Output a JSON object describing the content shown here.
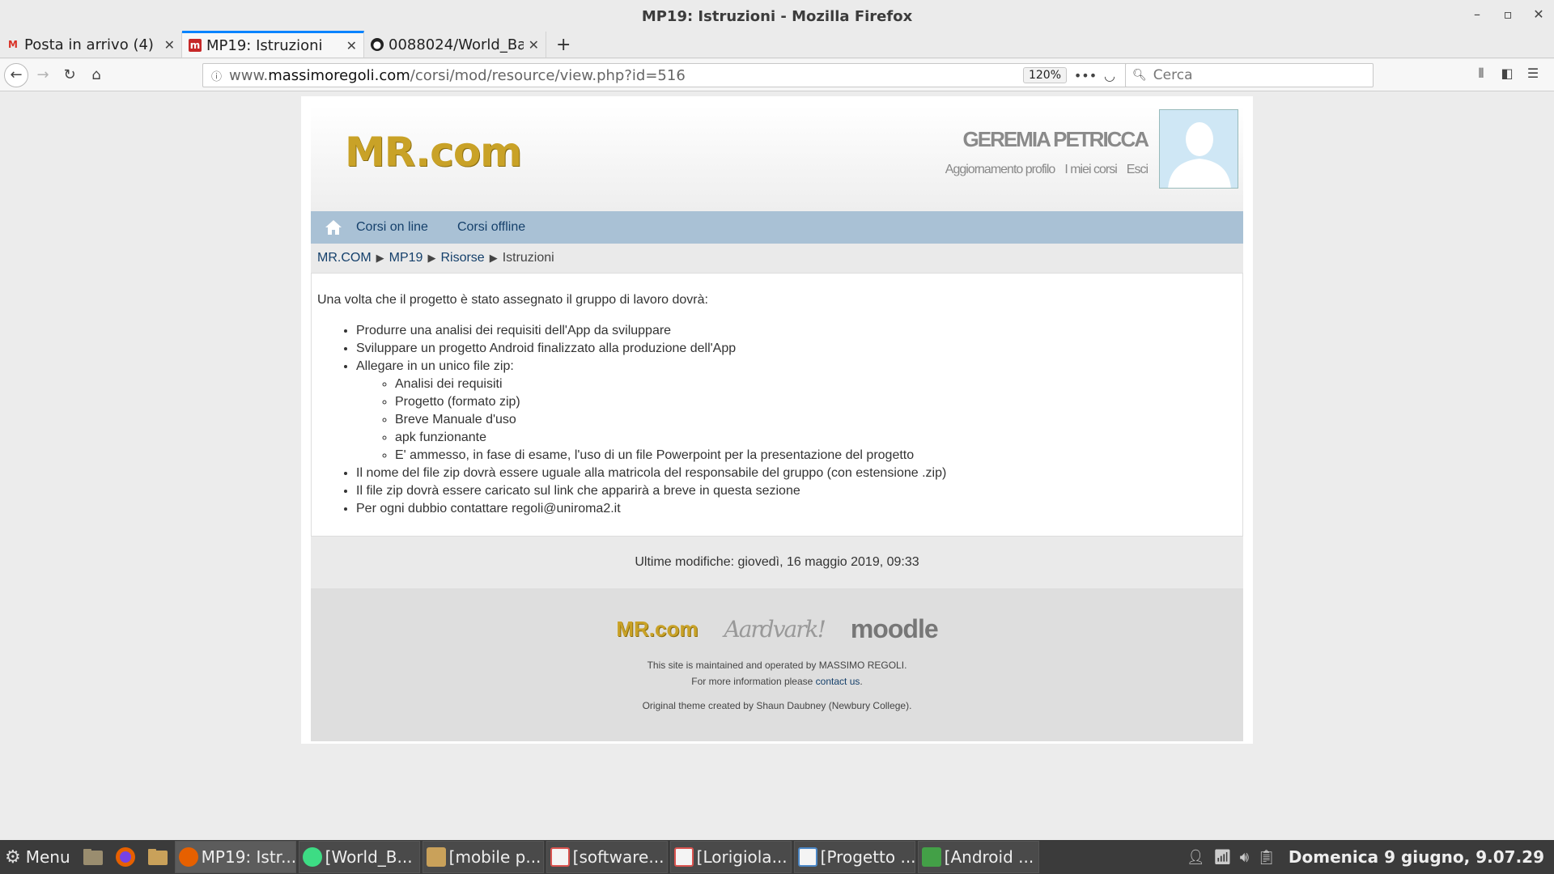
{
  "window": {
    "title": "MP19: Istruzioni - Mozilla Firefox"
  },
  "tabs": [
    {
      "label": "Posta in arrivo (4)",
      "icon": "gmail-icon"
    },
    {
      "label": "MP19: Istruzioni",
      "icon": "mr-favicon"
    },
    {
      "label": "0088024/World_Ba",
      "icon": "github-icon"
    }
  ],
  "navbar": {
    "url_prefix": "www.",
    "url_host": "massimoregoli.com",
    "url_path": "/corsi/mod/resource/view.php?id=516",
    "zoom": "120%",
    "search_placeholder": "Cerca"
  },
  "site": {
    "logo": "MR.com",
    "user_name": "GEREMIA PETRICCA",
    "user_links": [
      "Aggiornamento profilo",
      "I miei corsi",
      "Esci"
    ],
    "menu": [
      "Corsi on line",
      "Corsi offline"
    ],
    "breadcrumb": [
      "MR.COM",
      "MP19",
      "Risorse"
    ],
    "breadcrumb_current": "Istruzioni",
    "intro": "Una volta che il progetto è stato assegnato il gruppo di lavoro dovrà:",
    "items": [
      "Produrre una analisi dei requisiti dell'App da sviluppare",
      "Sviluppare un progetto Android finalizzato alla produzione dell'App",
      "Allegare in un unico file zip:"
    ],
    "subitems": [
      "Analisi dei requisiti",
      "Progetto (formato zip)",
      "Breve Manuale d'uso",
      "apk funzionante",
      "E' ammesso, in fase di esame, l'uso di un file Powerpoint per la presentazione del progetto"
    ],
    "items_after": [
      "Il nome del file zip dovrà essere uguale alla matricola del responsabile del gruppo (con estensione .zip)",
      "Il file zip dovrà essere caricato sul link che apparirà a breve in questa sezione",
      "Per ogni dubbio contattare regoli@uniroma2.it"
    ],
    "modified": "Ultime modifiche: giovedì, 16 maggio 2019, 09:33",
    "footer": {
      "logo_mr": "MR.com",
      "logo_aardvark": "Aardvark!",
      "logo_moodle": "moodle",
      "maintained": "This site is maintained and operated by MASSIMO REGOLI.",
      "more_info_prefix": "For more information please ",
      "contact_link": "contact us",
      "more_info_suffix": ".",
      "credit": "Original theme created by Shaun Daubney (Newbury College)."
    }
  },
  "taskbar": {
    "menu_label": "Menu",
    "items": [
      {
        "label": "MP19: Istr...",
        "icon_color": "#e66000"
      },
      {
        "label": "[World_B...",
        "icon_color": "#3ddc84"
      },
      {
        "label": "[mobile p...",
        "icon_color": "#c9a15a"
      },
      {
        "label": "[software...",
        "icon_color": "#d9534f"
      },
      {
        "label": "[Lorigiola...",
        "icon_color": "#d9534f"
      },
      {
        "label": "[Progetto ...",
        "icon_color": "#4a86c5"
      },
      {
        "label": "[Android ...",
        "icon_color": "#43a047"
      }
    ],
    "clock": "Domenica   9 giugno,   9.07.29"
  }
}
